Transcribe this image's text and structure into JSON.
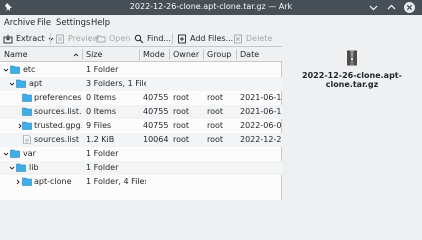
{
  "window": {
    "title": "2022-12-26-clone.apt-clone.tar.gz — Ark"
  },
  "menu": {
    "archive": "Archive",
    "file": "File",
    "settings": "Settings",
    "help": "Help"
  },
  "toolbar": {
    "extract": "Extract",
    "preview": "Preview",
    "open": "Open",
    "find": "Find...",
    "add_files": "Add Files...",
    "delete": "Delete"
  },
  "table": {
    "columns": [
      "Name",
      "Size",
      "Mode",
      "Owner",
      "Group",
      "Date"
    ],
    "rows": [
      {
        "name": "etc",
        "size": "1 Folder",
        "mode": "",
        "owner": "",
        "group": "",
        "date": ""
      },
      {
        "name": "apt",
        "size": "3 Folders, 1 File",
        "mode": "",
        "owner": "",
        "group": "",
        "date": ""
      },
      {
        "name": "preferences.d",
        "size": "0 Items",
        "mode": "40755",
        "owner": "root",
        "group": "root",
        "date": "2021-06-1..."
      },
      {
        "name": "sources.list.d",
        "size": "0 Items",
        "mode": "40755",
        "owner": "root",
        "group": "root",
        "date": "2021-06-1..."
      },
      {
        "name": "trusted.gpg.d",
        "size": "9 Files",
        "mode": "40755",
        "owner": "root",
        "group": "root",
        "date": "2022-06-0..."
      },
      {
        "name": "sources.list",
        "size": "1.2 KiB",
        "mode": "100644",
        "owner": "root",
        "group": "root",
        "date": "2022-12-2..."
      },
      {
        "name": "var",
        "size": "1 Folder",
        "mode": "",
        "owner": "",
        "group": "",
        "date": ""
      },
      {
        "name": "lib",
        "size": "1 Folder",
        "mode": "",
        "owner": "",
        "group": "",
        "date": ""
      },
      {
        "name": "apt-clone",
        "size": "1 Folder, 4 Files",
        "mode": "",
        "owner": "",
        "group": "",
        "date": ""
      }
    ]
  },
  "info": {
    "filename": "2022-12-26-clone.apt-clone.tar.gz"
  },
  "colors": {
    "titlebar": "#475057",
    "window_bg": "#eff0f1",
    "view_bg": "#fcfcfc",
    "folder": "#3daee9",
    "accent": "#2980b9"
  }
}
